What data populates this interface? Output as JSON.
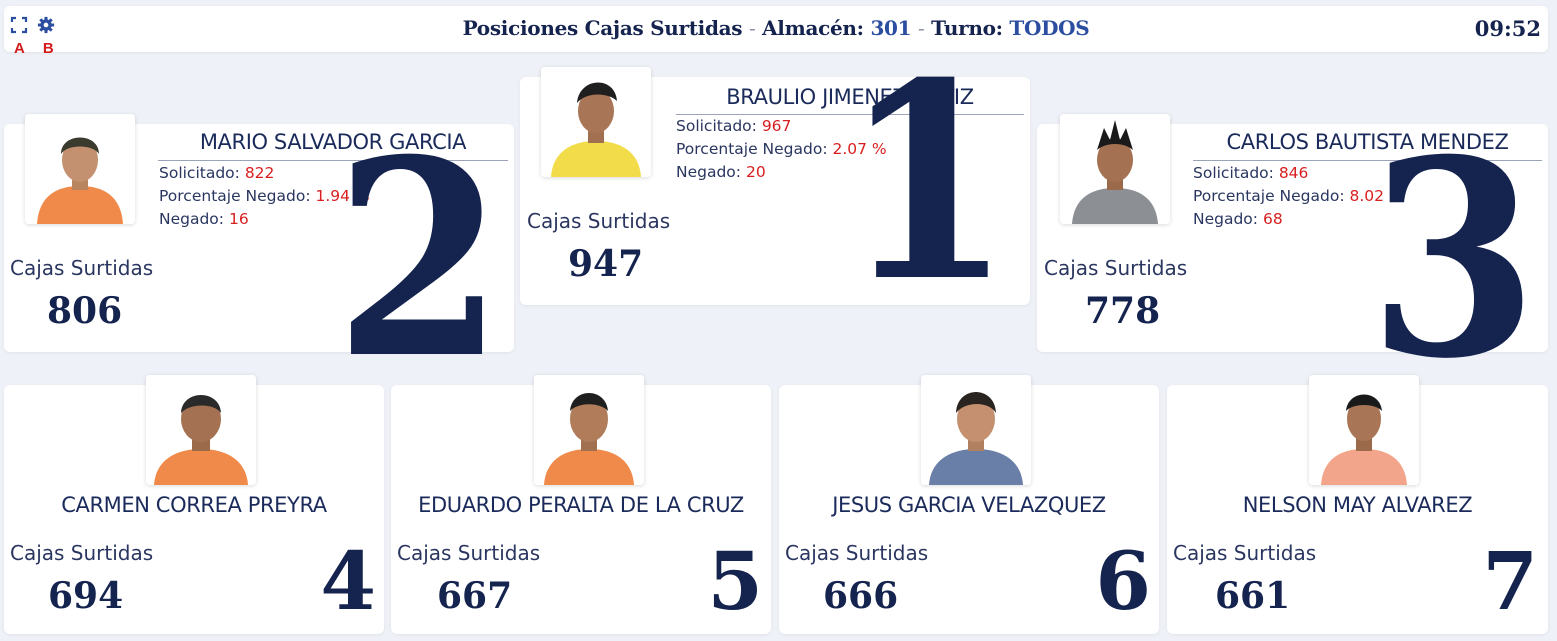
{
  "header": {
    "title_prefix": "Posiciones Cajas Surtidas",
    "separator": "-",
    "almacen_label": "Almacén:",
    "almacen_value": "301",
    "turno_label": "Turno:",
    "turno_value": "TODOS",
    "time": "09:52",
    "fullscreen_icon": "fullscreen-icon",
    "settings_icon": "gear-icon",
    "mark_a": "A",
    "mark_b": "B"
  },
  "labels": {
    "solicitado": "Solicitado: ",
    "porcentaje_negado": "Porcentaje Negado: ",
    "negado": "Negado: ",
    "cajas_surtidas": "Cajas Surtidas"
  },
  "podium": [
    {
      "rank": "1",
      "name": "BRAULIO JIMENEZ ORTIZ",
      "solicitado": "967",
      "porcentaje_negado": "2.07 %",
      "negado": "20",
      "cajas": "947",
      "shirt": "#f2dc4a"
    },
    {
      "rank": "2",
      "name": "MARIO SALVADOR GARCIA",
      "solicitado": "822",
      "porcentaje_negado": "1.94 %",
      "negado": "16",
      "cajas": "806",
      "shirt": "#f08a4a"
    },
    {
      "rank": "3",
      "name": "CARLOS BAUTISTA MENDEZ",
      "solicitado": "846",
      "porcentaje_negado": "8.02 %",
      "negado": "68",
      "cajas": "778",
      "shirt": "#8c8f93"
    }
  ],
  "others": [
    {
      "rank": "4",
      "name": "CARMEN CORREA PREYRA",
      "cajas": "694",
      "shirt": "#f08a4a"
    },
    {
      "rank": "5",
      "name": "EDUARDO PERALTA DE LA CRUZ",
      "cajas": "667",
      "shirt": "#f08a4a"
    },
    {
      "rank": "6",
      "name": "JESUS GARCIA VELAZQUEZ",
      "cajas": "666",
      "shirt": "#6a7fa8"
    },
    {
      "rank": "7",
      "name": "NELSON MAY ALVAREZ",
      "cajas": "661",
      "shirt": "#f2a58a"
    }
  ],
  "colors": {
    "navy": "#15234f",
    "accent": "#2c4ea0",
    "red": "#d81f1f"
  }
}
